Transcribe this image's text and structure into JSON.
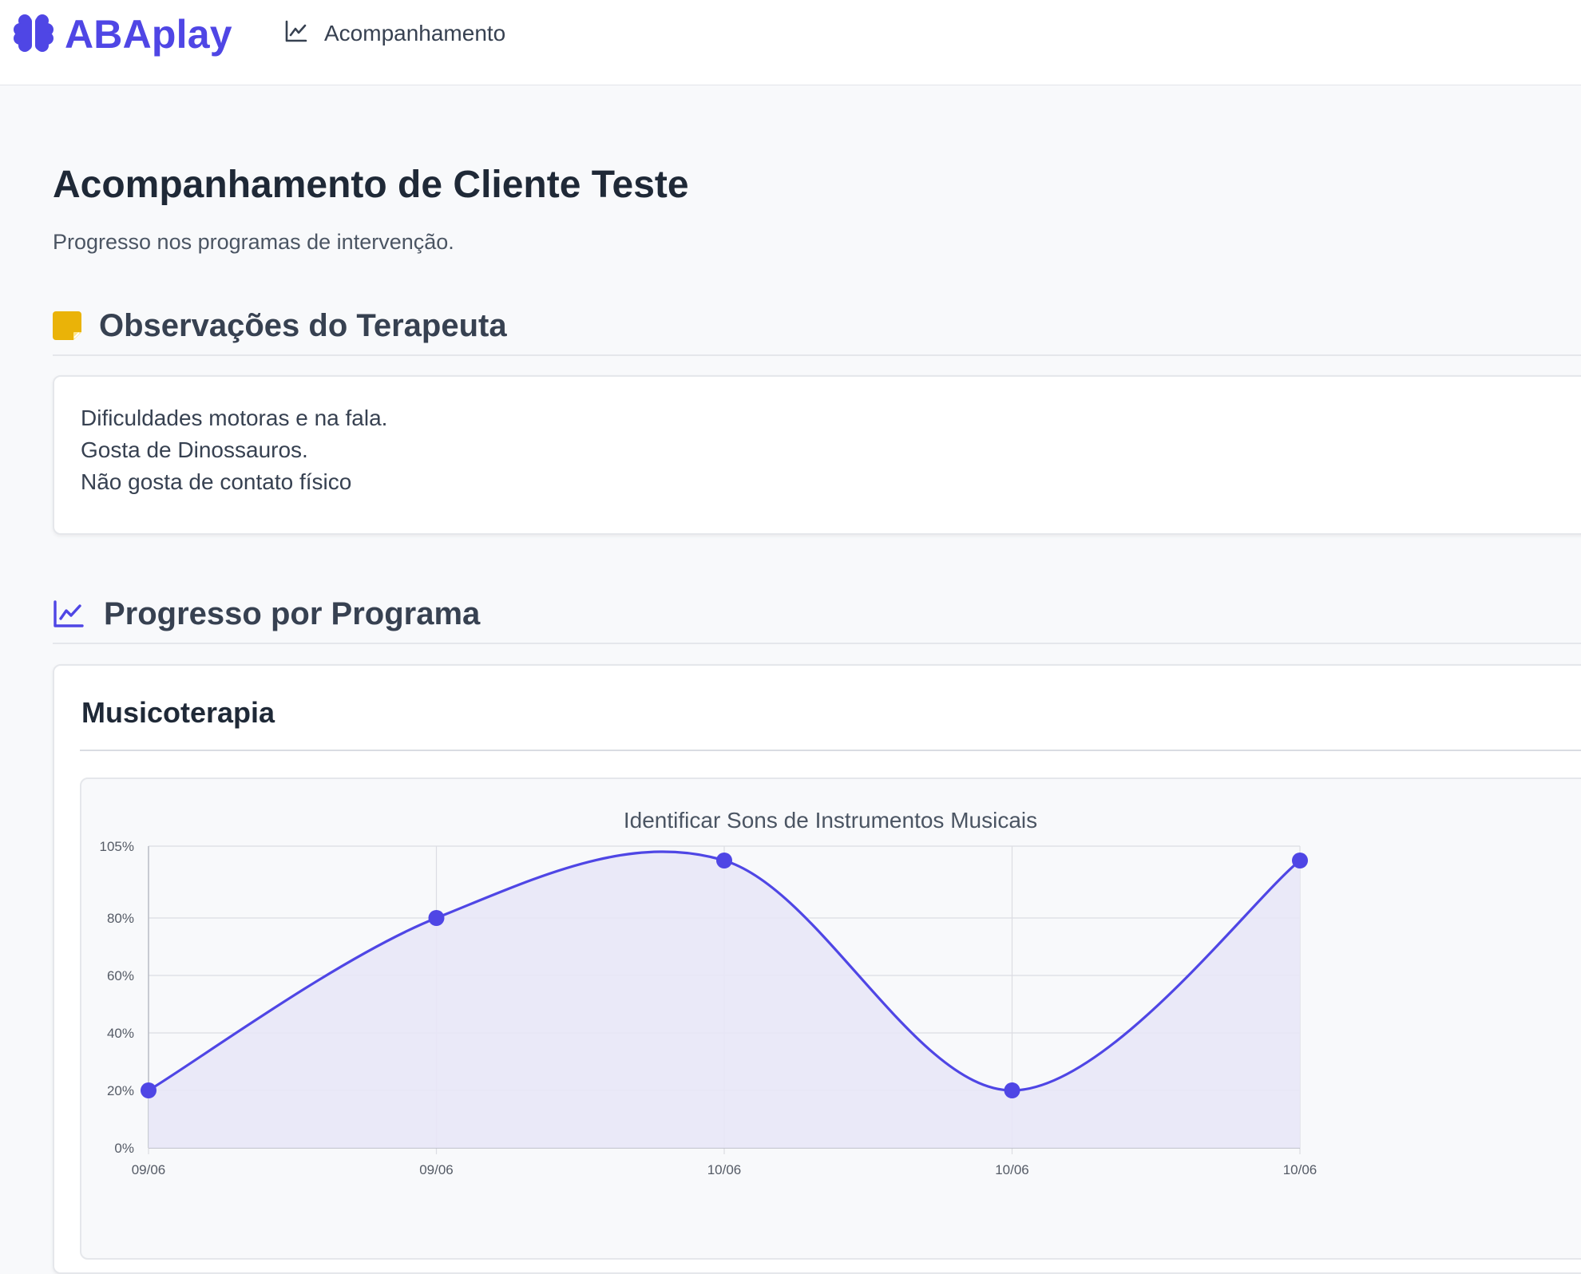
{
  "app": {
    "name": "ABAplay",
    "logo_icon": "brain-icon",
    "brand_color": "#4f46e5"
  },
  "nav": {
    "items": [
      {
        "label": "Acompanhamento",
        "icon": "chart-line-icon"
      }
    ]
  },
  "page": {
    "title": "Acompanhamento de Cliente Teste",
    "subtitle": "Progresso nos programas de intervenção."
  },
  "observations": {
    "title": "Observações do Terapeuta",
    "icon": "sticky-note-icon",
    "icon_color": "#eab308",
    "lines": [
      "Dificuldades motoras e na fala.",
      "Gosta de Dinossauros.",
      "Não gosta de contato físico"
    ]
  },
  "progress": {
    "title": "Progresso por Programa",
    "icon": "chart-line-icon",
    "programs": [
      {
        "name": "Musicoterapia"
      }
    ]
  },
  "chart_data": {
    "type": "area",
    "title": "Identificar Sons de Instrumentos Musicais",
    "xlabel": "",
    "ylabel": "",
    "categories": [
      "09/06",
      "09/06",
      "10/06",
      "10/06",
      "10/06"
    ],
    "series": [
      {
        "values": [
          20,
          80,
          100,
          20,
          100
        ]
      }
    ],
    "ylim": [
      0,
      105
    ],
    "y_ticks": [
      0,
      20,
      40,
      60,
      80,
      105
    ],
    "y_tick_labels": [
      "0%",
      "20%",
      "40%",
      "60%",
      "80%",
      "105%"
    ],
    "grid": true,
    "line_color": "#4f46e5",
    "fill_color": "#e8e7f7",
    "smooth": true
  }
}
